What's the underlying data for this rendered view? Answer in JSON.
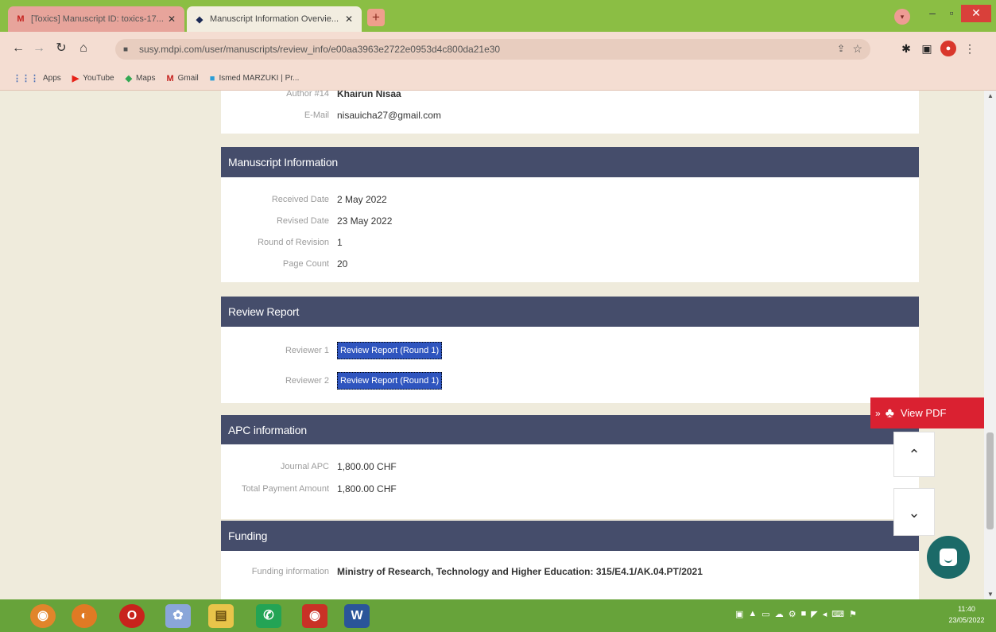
{
  "browser": {
    "tabs": [
      {
        "favicon": "M",
        "title": "[Toxics] Manuscript ID: toxics-17...",
        "close": "✕"
      },
      {
        "favicon": "◆",
        "title": "Manuscript Information Overvie...",
        "close": "✕"
      }
    ],
    "new_tab": "+",
    "url": "susy.mdpi.com/user/manuscripts/review_info/e00aa3963e2722e0953d4c800da21e30",
    "bookmarks": [
      {
        "icon": "grid-icon",
        "label": "Apps"
      },
      {
        "icon": "youtube-icon",
        "label": "YouTube"
      },
      {
        "icon": "maps-icon",
        "label": "Maps"
      },
      {
        "icon": "gmail-icon",
        "label": "Gmail"
      },
      {
        "icon": "profile-icon",
        "label": "Ismed MARZUKI | Pr..."
      }
    ]
  },
  "author": {
    "name_label": "Author #14",
    "name_value": "Khairun Nisaa",
    "email_label": "E-Mail",
    "email_value": "nisauicha27@gmail.com"
  },
  "manuscript_info": {
    "title": "Manuscript Information",
    "rows": [
      {
        "label": "Received Date",
        "value": "2 May 2022"
      },
      {
        "label": "Revised Date",
        "value": "23 May 2022"
      },
      {
        "label": "Round of Revision",
        "value": "1"
      },
      {
        "label": "Page Count",
        "value": "20"
      }
    ]
  },
  "review_report": {
    "title": "Review Report",
    "rows": [
      {
        "label": "Reviewer 1",
        "value": "Review Report (Round 1)"
      },
      {
        "label": "Reviewer 2",
        "value": "Review Report (Round 1)"
      }
    ]
  },
  "apc": {
    "title": "APC information",
    "rows": [
      {
        "label": "Journal APC",
        "value": "1,800.00 CHF"
      },
      {
        "label": "Total Payment Amount",
        "value": "1,800.00 CHF"
      }
    ]
  },
  "funding": {
    "title": "Funding",
    "rows": [
      {
        "label": "Funding information",
        "value": "Ministry of Research, Technology and Higher Education: 315/E4.1/AK.04.PT/2021"
      }
    ]
  },
  "widgets": {
    "view_pdf": "View PDF"
  },
  "taskbar": {
    "time": "11:40",
    "date": "23/05/2022"
  },
  "colors": {
    "section_header": "#454d6b",
    "report_button": "#2f55bf",
    "view_pdf": "#da2131",
    "chat": "#1b6a68",
    "tab_strip": "#8bbe44",
    "taskbar": "#67a33a"
  }
}
